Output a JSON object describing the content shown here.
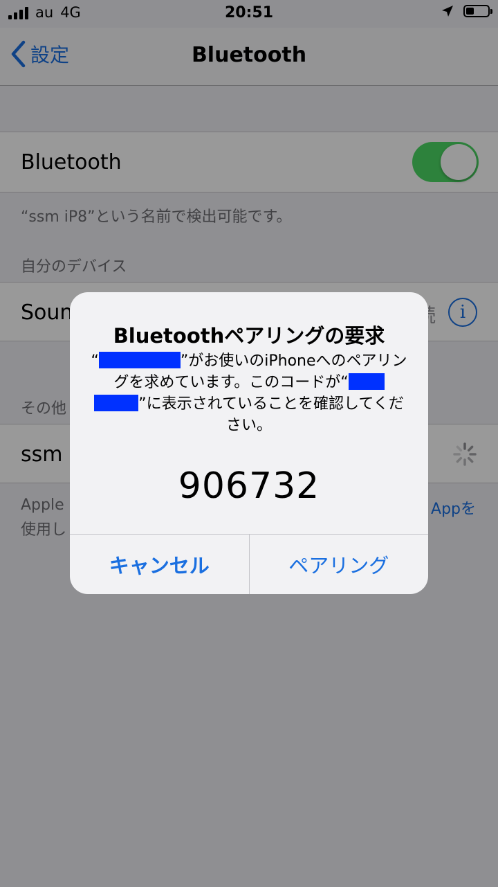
{
  "status_bar": {
    "carrier": "au",
    "network": "4G",
    "time": "20:51"
  },
  "nav": {
    "back_label": "設定",
    "title": "Bluetooth"
  },
  "bluetooth_cell": {
    "label": "Bluetooth",
    "toggle_on": true
  },
  "discoverable_text": "“ssm iP8”という名前で検出可能です。",
  "my_devices": {
    "header": "自分のデバイス",
    "device_label": "Sound",
    "device_status": "続"
  },
  "other_devices": {
    "header": "その他",
    "device_label": "ssm i"
  },
  "footer": {
    "line1_left": "Apple",
    "line1_right": "Appを",
    "line2_left": "使用し"
  },
  "alert": {
    "title": "Bluetoothペアリングの要求",
    "msg_open_quote": "“",
    "msg_part1": "”がお使いのiPhoneへのペアリングを求めています。このコードが“",
    "msg_part2": "”に表示されていることを確認してください。",
    "code": "906732",
    "cancel_label": "キャンセル",
    "pair_label": "ペアリング"
  },
  "colors": {
    "accent": "#1a6fe0",
    "toggle_on": "#4cd964",
    "redaction": "#0031ff"
  }
}
